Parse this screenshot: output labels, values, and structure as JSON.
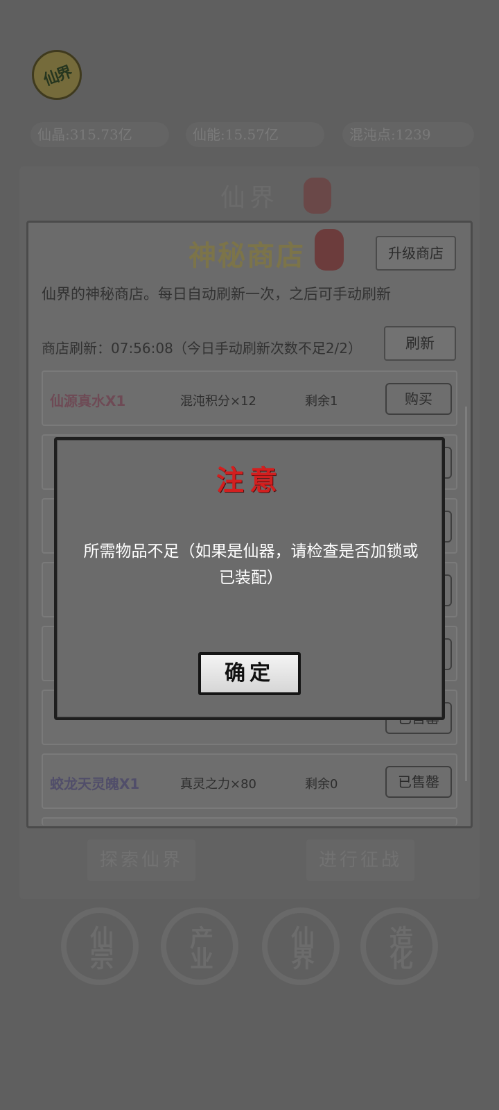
{
  "header": {
    "avatar_text": "仙界",
    "stats": [
      "仙晶:315.73亿",
      "仙能:15.57亿",
      "混沌点:1239"
    ]
  },
  "outer": {
    "title": "仙界",
    "bottom_buttons": [
      "探索仙界",
      "进行征战"
    ],
    "nav": [
      "仙宗",
      "产业",
      "仙界",
      "造化"
    ]
  },
  "shop": {
    "title": "神秘商店",
    "upgrade_label": "升级商店",
    "description": "仙界的神秘商店。每日自动刷新一次，之后可手动刷新",
    "refresh_info": "商店刷新：07:56:08（今日手动刷新次数不足2/2）",
    "refresh_label": "刷新",
    "items": [
      {
        "name": "仙源真水X1",
        "cost": "混沌积分×12",
        "remain": "剩余1",
        "action": "购买"
      },
      {
        "name": "",
        "cost": "",
        "remain": "",
        "action": ""
      },
      {
        "name": "",
        "cost": "",
        "remain": "",
        "action": ""
      },
      {
        "name": "",
        "cost": "",
        "remain": "",
        "action": ""
      },
      {
        "name": "",
        "cost": "",
        "remain": "",
        "action": ""
      },
      {
        "name": "",
        "cost": "",
        "remain": "",
        "action": "已售罄"
      },
      {
        "name": "蛟龙天灵魄X1",
        "cost": "真灵之力×80",
        "remain": "剩余0",
        "action": "已售罄"
      }
    ]
  },
  "dialog": {
    "title": "注意",
    "message": "所需物品不足（如果是仙器，请检查是否加锁或已装配）",
    "confirm_label": "确定"
  }
}
